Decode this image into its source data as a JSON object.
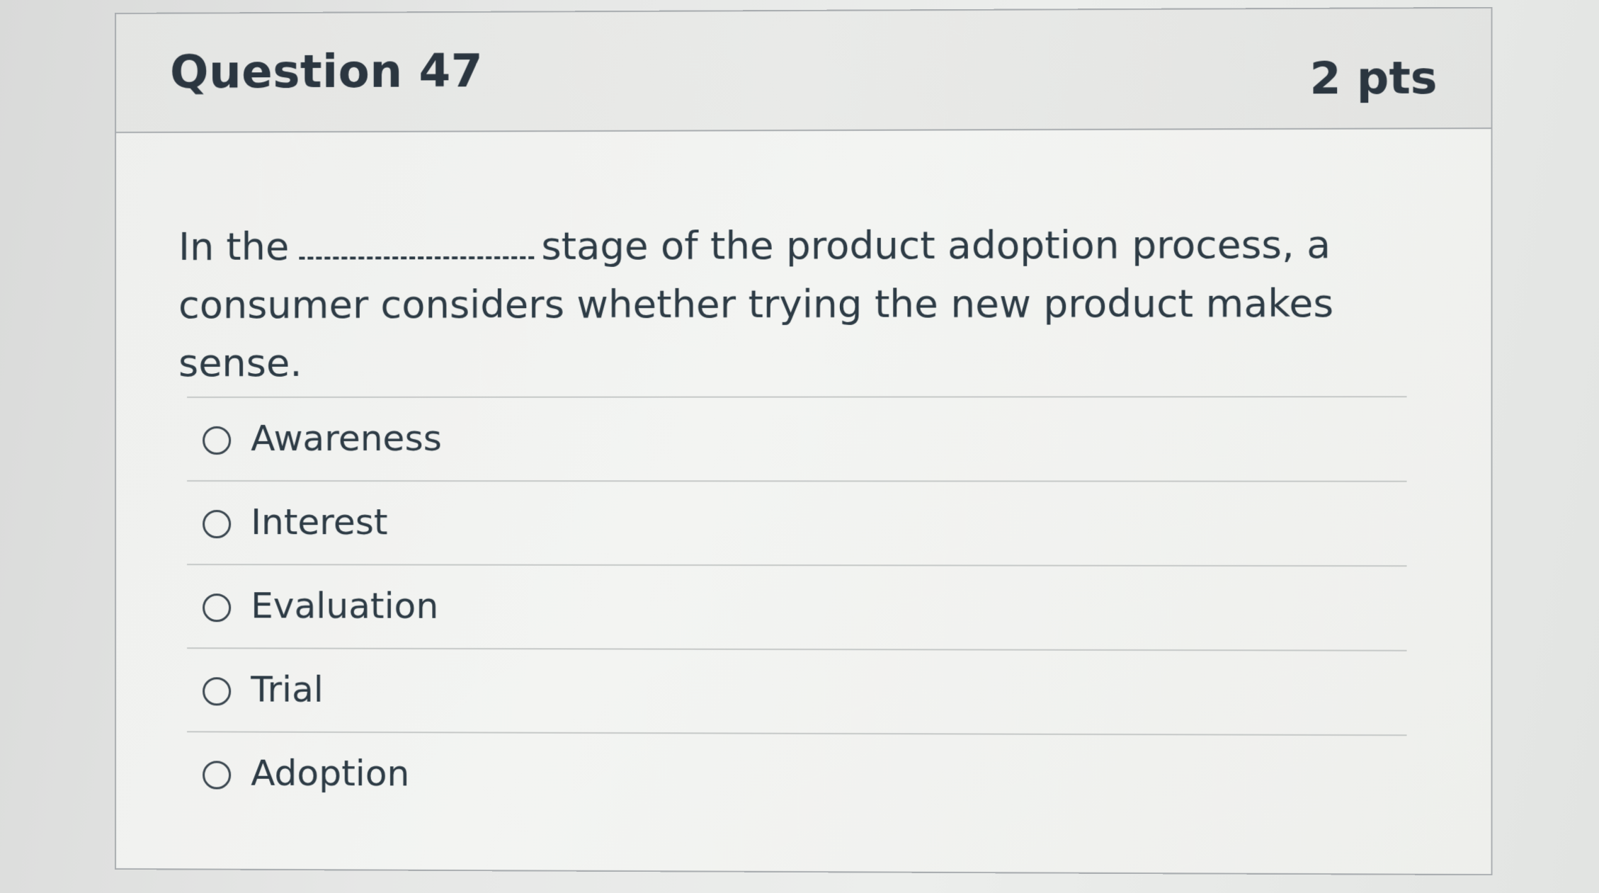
{
  "question": {
    "title": "Question 47",
    "points": "2 pts",
    "text_before_blank": "In the",
    "text_after_blank": "stage of the product adoption process, a consumer considers whether trying the new product makes sense."
  },
  "answers": [
    {
      "label": "Awareness",
      "selected": false
    },
    {
      "label": "Interest",
      "selected": false
    },
    {
      "label": "Evaluation",
      "selected": false
    },
    {
      "label": "Trial",
      "selected": false
    },
    {
      "label": "Adoption",
      "selected": false
    }
  ]
}
